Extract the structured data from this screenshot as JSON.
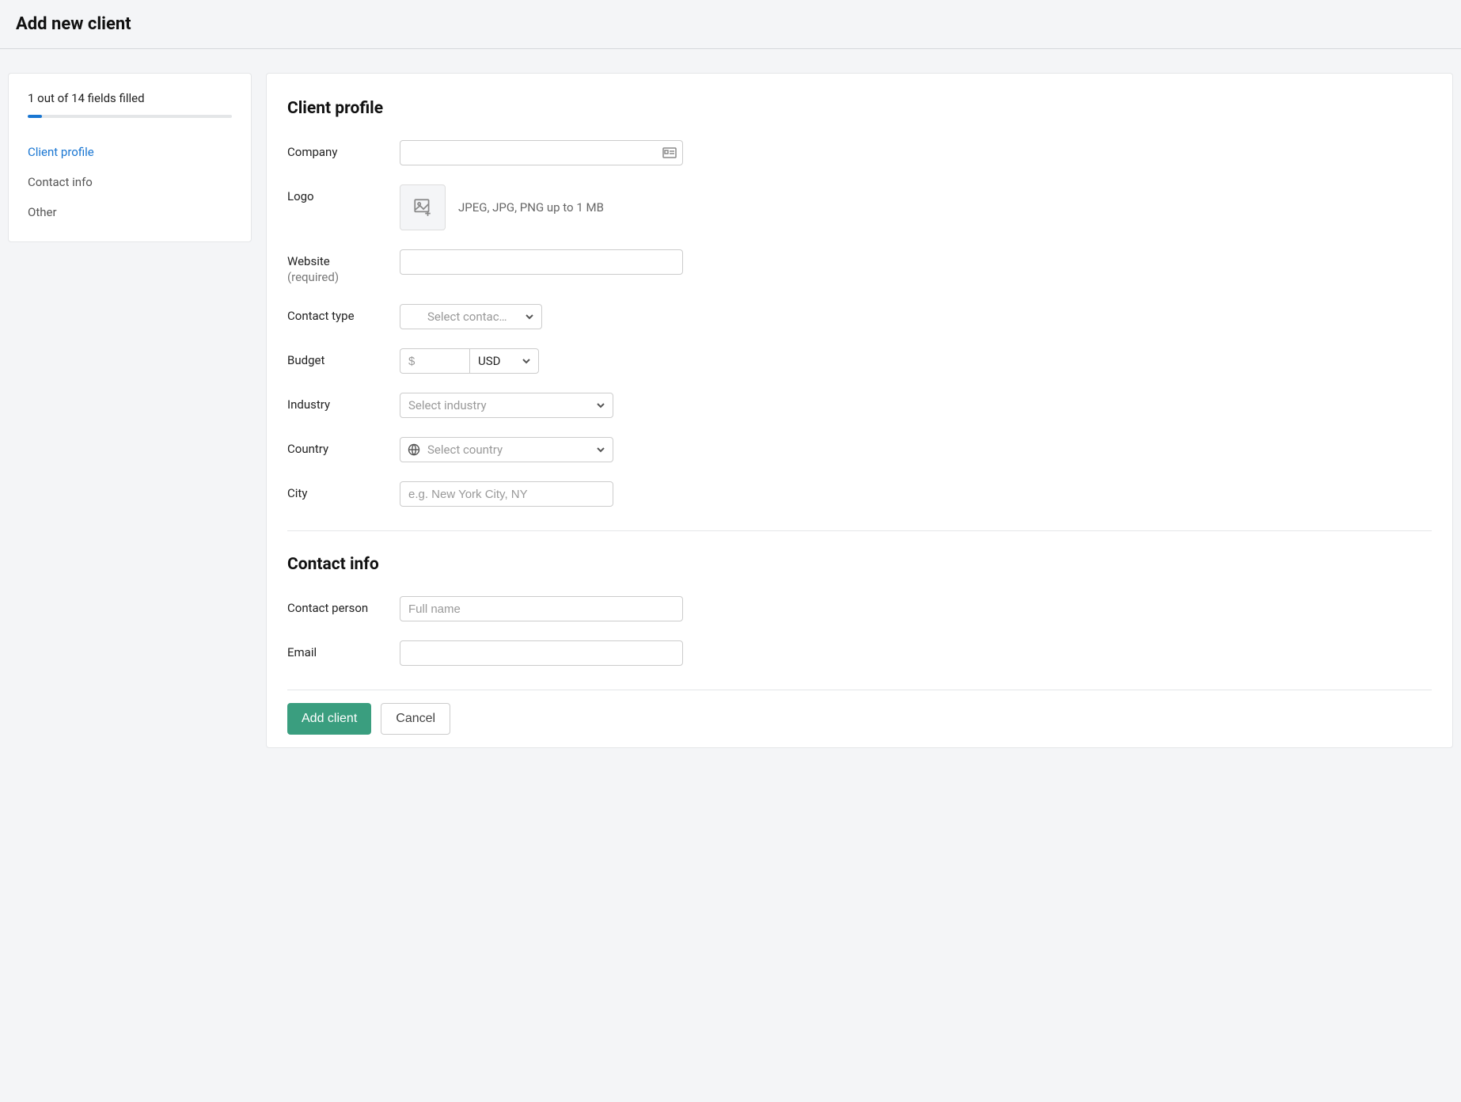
{
  "header": {
    "title": "Add new client"
  },
  "sidebar": {
    "progress_text": "1 out of 14 fields filled",
    "progress_percent": 7,
    "nav": [
      {
        "label": "Client profile",
        "active": true
      },
      {
        "label": "Contact info",
        "active": false
      },
      {
        "label": "Other",
        "active": false
      }
    ]
  },
  "sections": {
    "client_profile": {
      "title": "Client profile",
      "fields": {
        "company": {
          "label": "Company"
        },
        "logo": {
          "label": "Logo",
          "hint": "JPEG, JPG, PNG up to 1 MB"
        },
        "website": {
          "label": "Website",
          "sublabel": "(required)"
        },
        "contact_type": {
          "label": "Contact type",
          "placeholder": "Select contac…"
        },
        "budget": {
          "label": "Budget",
          "placeholder": "$",
          "currency": "USD"
        },
        "industry": {
          "label": "Industry",
          "placeholder": "Select industry"
        },
        "country": {
          "label": "Country",
          "placeholder": "Select country"
        },
        "city": {
          "label": "City",
          "placeholder": "e.g. New York City, NY"
        }
      }
    },
    "contact_info": {
      "title": "Contact info",
      "fields": {
        "contact_person": {
          "label": "Contact person",
          "placeholder": "Full name"
        },
        "email": {
          "label": "Email"
        }
      }
    }
  },
  "footer": {
    "primary": "Add client",
    "secondary": "Cancel"
  }
}
